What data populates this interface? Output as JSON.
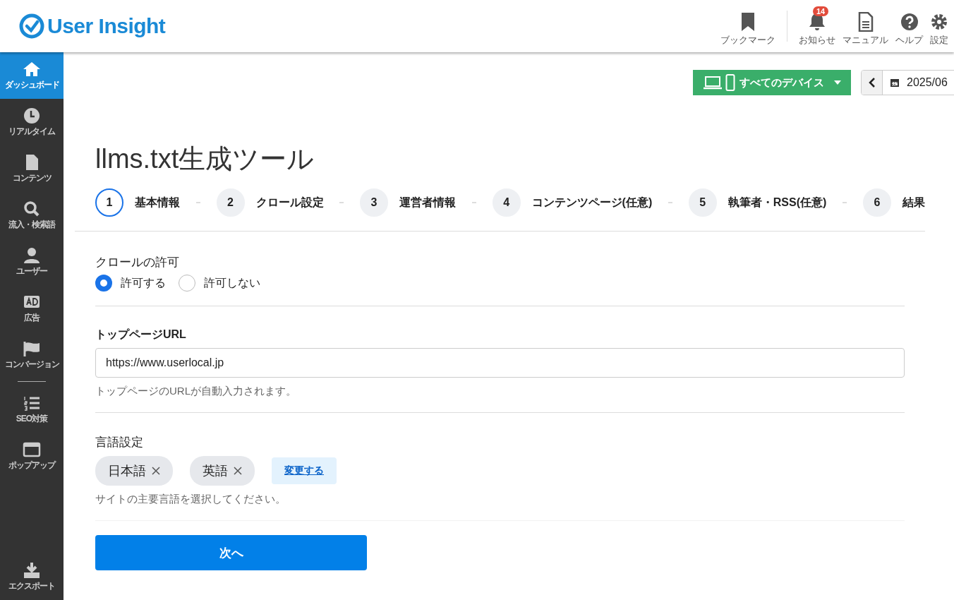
{
  "header": {
    "logo": "User Insight",
    "actions": [
      {
        "label": "ブックマーク"
      },
      {
        "label": "お知らせ",
        "badge": "14"
      },
      {
        "label": "マニュアル"
      },
      {
        "label": "ヘルプ"
      },
      {
        "label": "設定"
      }
    ]
  },
  "sidebar": {
    "items": [
      {
        "kind": "link",
        "label": "ダッシュボード",
        "selected": true
      },
      {
        "kind": "link",
        "label": "リアルタイム",
        "selected": false
      },
      {
        "kind": "link",
        "label": "コンテンツ",
        "selected": false
      },
      {
        "kind": "link",
        "label": "流入・検索語",
        "selected": false
      },
      {
        "kind": "link",
        "label": "ユーザー",
        "selected": false
      },
      {
        "kind": "link",
        "label": "広告",
        "selected": false
      },
      {
        "kind": "link",
        "label": "コンバージョン",
        "selected": false
      },
      {
        "kind": "separator"
      },
      {
        "kind": "link",
        "label": "SEO対策",
        "selected": false
      },
      {
        "kind": "link",
        "label": "ポップアップ",
        "selected": false
      }
    ],
    "footer_item": {
      "label": "エクスポート"
    }
  },
  "toolbar": {
    "device_button": "すべてのデバイス",
    "date": "2025/06"
  },
  "title": "llms.txt生成ツール",
  "steps": [
    {
      "number": "1",
      "label": "基本情報",
      "selected": true
    },
    {
      "number": "2",
      "label": "クロール設定",
      "selected": false
    },
    {
      "number": "3",
      "label": "運営者情報",
      "selected": false
    },
    {
      "number": "4",
      "label": "コンテンツページ(任意)",
      "selected": false
    },
    {
      "number": "5",
      "label": "執筆者・RSS(任意)",
      "selected": false
    },
    {
      "number": "6",
      "label": "結果",
      "selected": false
    }
  ],
  "form": {
    "sections": [
      {
        "kind": "radio",
        "label": "クロールの許可",
        "options": [
          {
            "label": "許可する",
            "selected": true
          },
          {
            "label": "許可しない",
            "selected": false
          }
        ]
      },
      {
        "kind": "text",
        "label": "トップページURL",
        "value": "https://www.userlocal.jp",
        "help": "トップページのURLが自動入力されます。"
      },
      {
        "kind": "tags",
        "label": "言語設定",
        "tags": [
          "日本語",
          "英語"
        ],
        "action": "変更する",
        "help": "サイトの主要言語を選択してください。"
      }
    ],
    "submit": "次へ"
  }
}
